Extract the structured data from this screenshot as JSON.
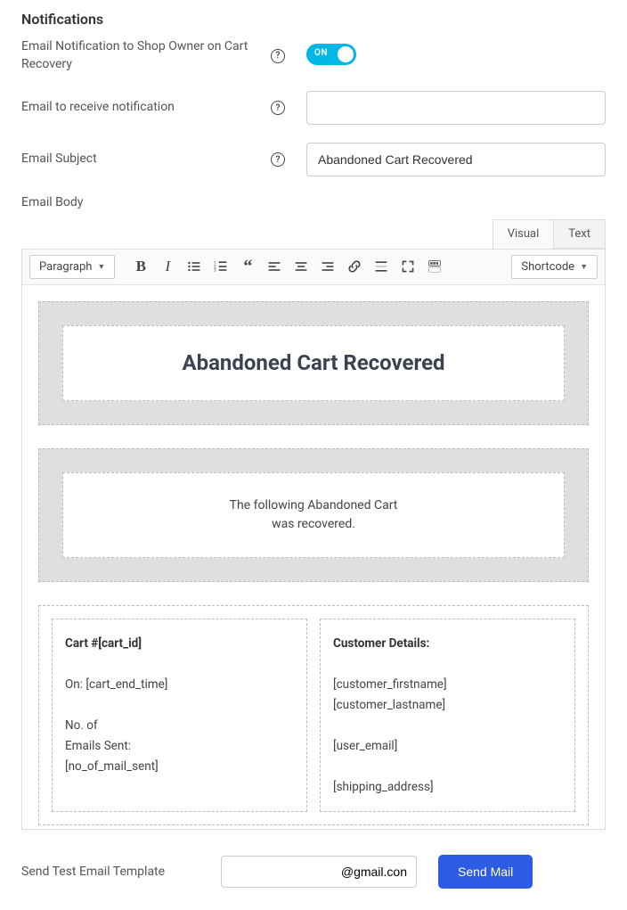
{
  "section_title": "Notifications",
  "fields": {
    "notify_owner": {
      "label": "Email Notification to Shop Owner on Cart Recovery",
      "toggle_on_label": "ON"
    },
    "receive_email": {
      "label": "Email to receive notification",
      "value": ""
    },
    "subject": {
      "label": "Email Subject",
      "value": "Abandoned Cart Recovered"
    },
    "body_label": "Email Body"
  },
  "editor": {
    "tab_visual": "Visual",
    "tab_text": "Text",
    "paragraph_select": "Paragraph",
    "shortcode_select": "Shortcode"
  },
  "template": {
    "heading": "Abandoned Cart Recovered",
    "message_line1": "The following Abandoned Cart",
    "message_line2": "was recovered.",
    "cart": {
      "header": "Cart #[cart_id]",
      "on_label": "On: [cart_end_time]",
      "mails_line1": "No. of",
      "mails_line2": "Emails Sent:",
      "mails_line3": "[no_of_mail_sent]"
    },
    "customer": {
      "header": "Customer Details:",
      "line1": "[customer_firstname]",
      "line2": "[customer_lastname]",
      "line3": "[user_email]",
      "line4": "[shipping_address]"
    }
  },
  "footer": {
    "label": "Send Test Email Template",
    "value": "@gmail.con",
    "button": "Send Mail"
  }
}
